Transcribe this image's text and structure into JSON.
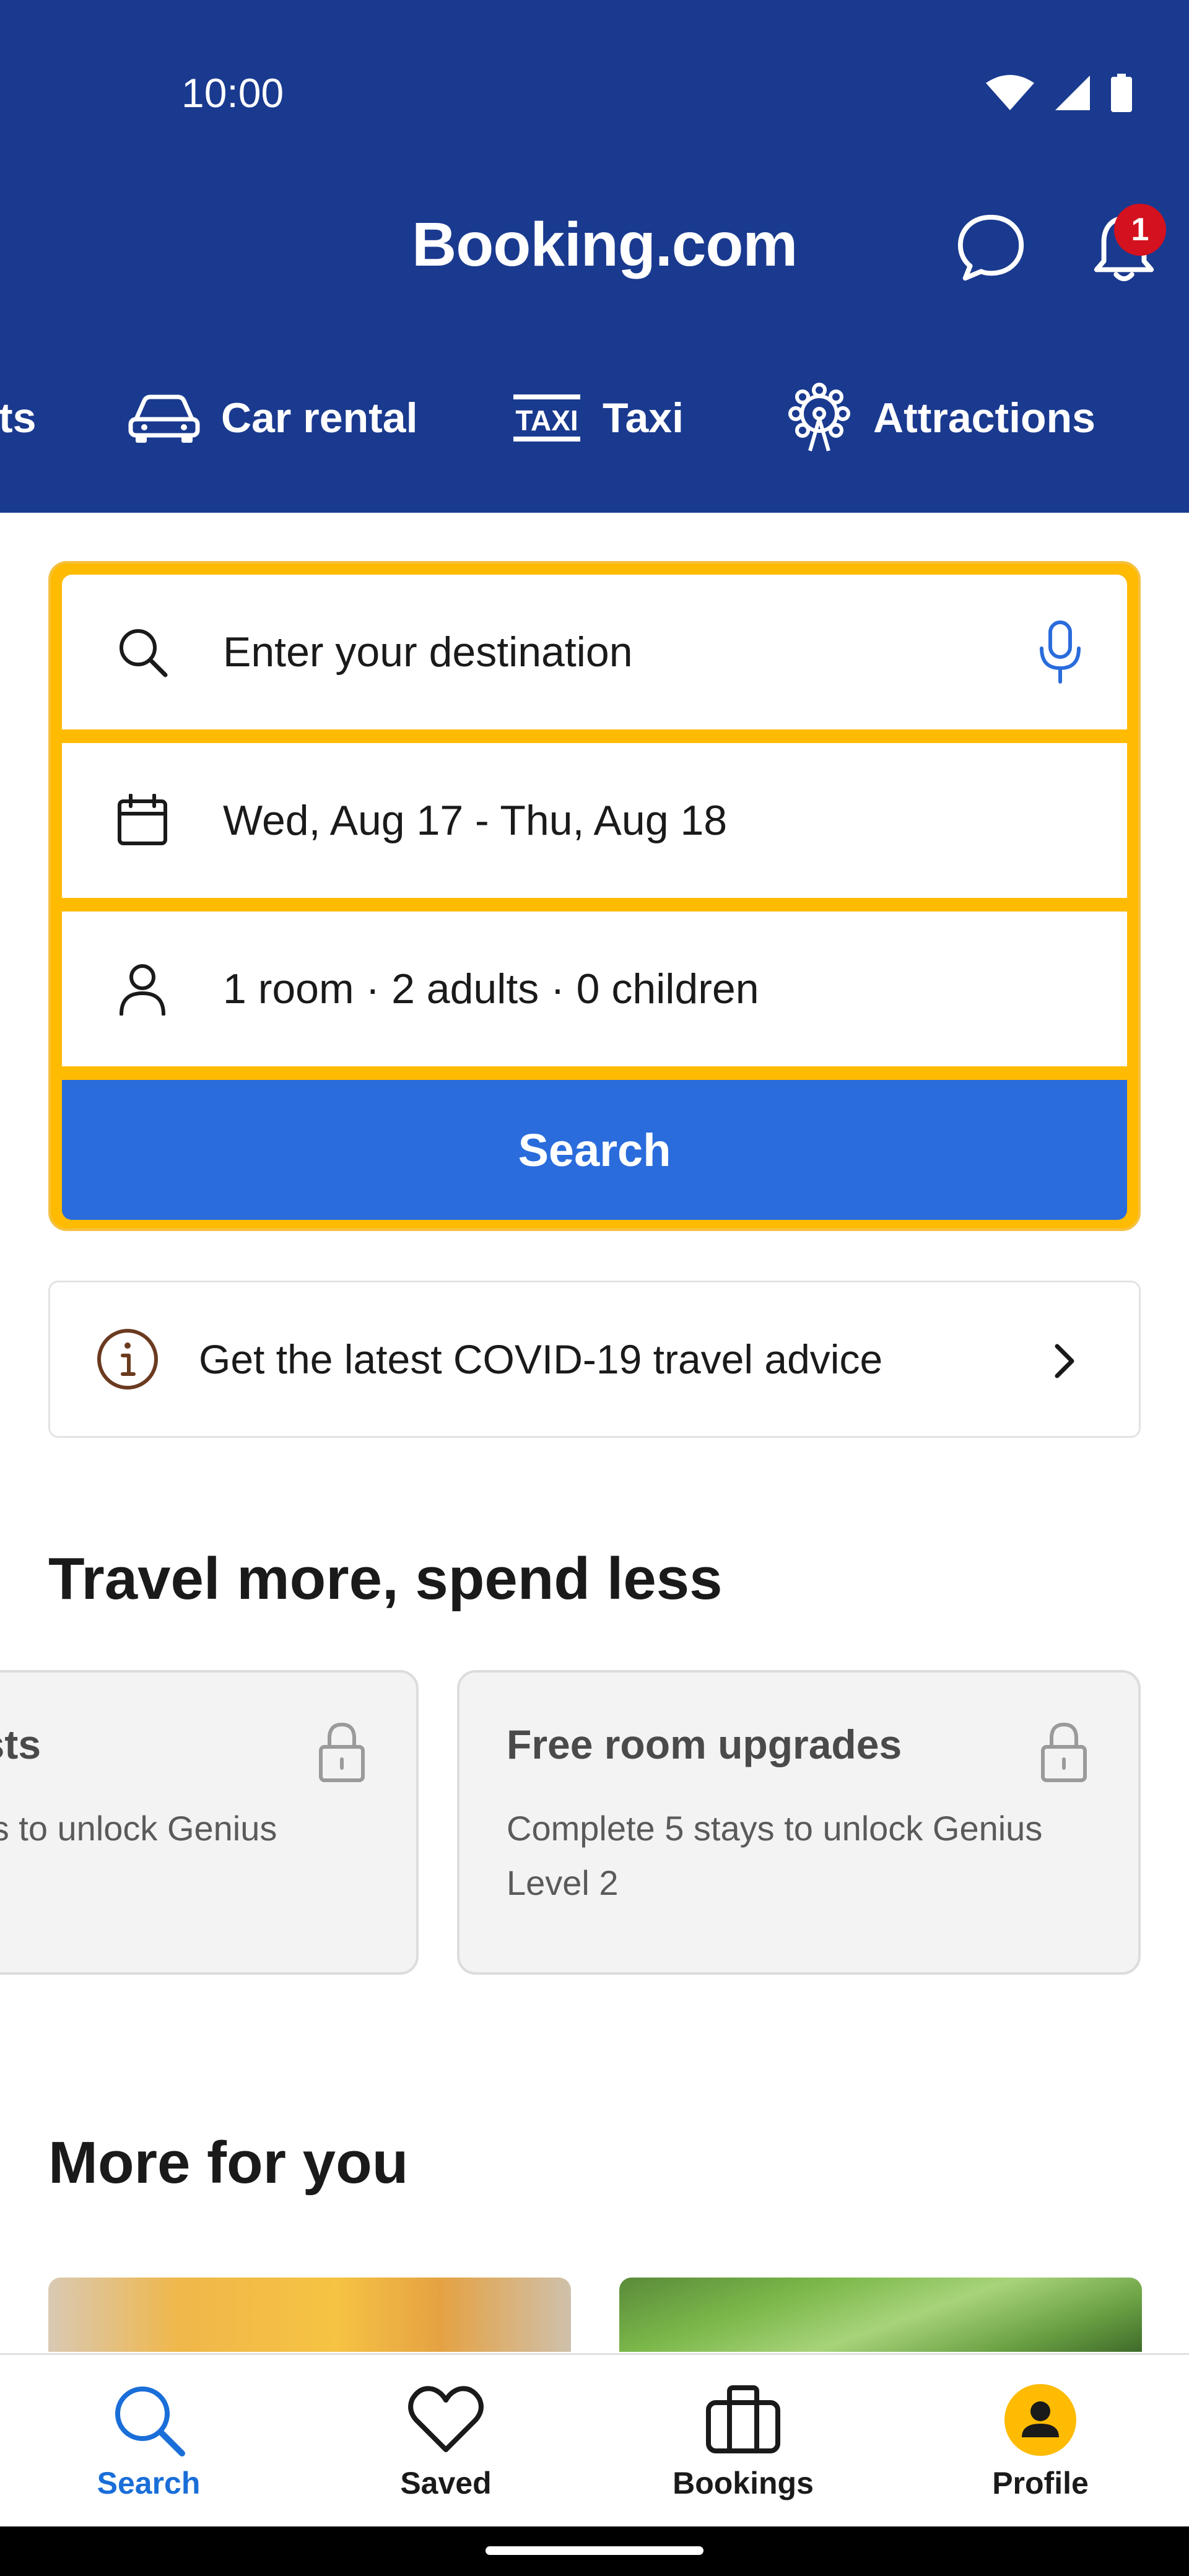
{
  "status_bar": {
    "time": "10:00"
  },
  "header": {
    "brand": "Booking.com",
    "notification_count": "1",
    "categories": [
      {
        "label": "ts",
        "icon": "stays-icon"
      },
      {
        "label": "Car rental",
        "icon": "car-icon"
      },
      {
        "label": "Taxi",
        "icon": "taxi-icon"
      },
      {
        "label": "Attractions",
        "icon": "attractions-icon"
      }
    ]
  },
  "search": {
    "destination_placeholder": "Enter your destination",
    "dates": "Wed, Aug 17 - Thu, Aug 18",
    "occupancy": "1 room · 2 adults · 0 children",
    "button_label": "Search"
  },
  "covid": {
    "text": "Get the latest COVID-19 travel advice"
  },
  "travel_section": {
    "title": "Travel more, spend less",
    "cards": [
      {
        "title": "fasts",
        "desc": "tays to unlock Genius",
        "locked": true
      },
      {
        "title": "Free room upgrades",
        "desc": "Complete 5 stays to unlock Genius Level 2",
        "locked": true
      }
    ]
  },
  "more_section": {
    "title": "More for you"
  },
  "bottom_nav": {
    "items": [
      {
        "label": "Search",
        "icon": "search-icon",
        "active": true
      },
      {
        "label": "Saved",
        "icon": "heart-icon",
        "active": false
      },
      {
        "label": "Bookings",
        "icon": "suitcase-icon",
        "active": false
      },
      {
        "label": "Profile",
        "icon": "profile-icon",
        "active": false
      }
    ]
  },
  "colors": {
    "header_bg": "#1a3a8f",
    "search_border": "#febb02",
    "search_button": "#2a6cdc",
    "active_nav": "#1a6ed8",
    "badge": "#d4111e"
  }
}
